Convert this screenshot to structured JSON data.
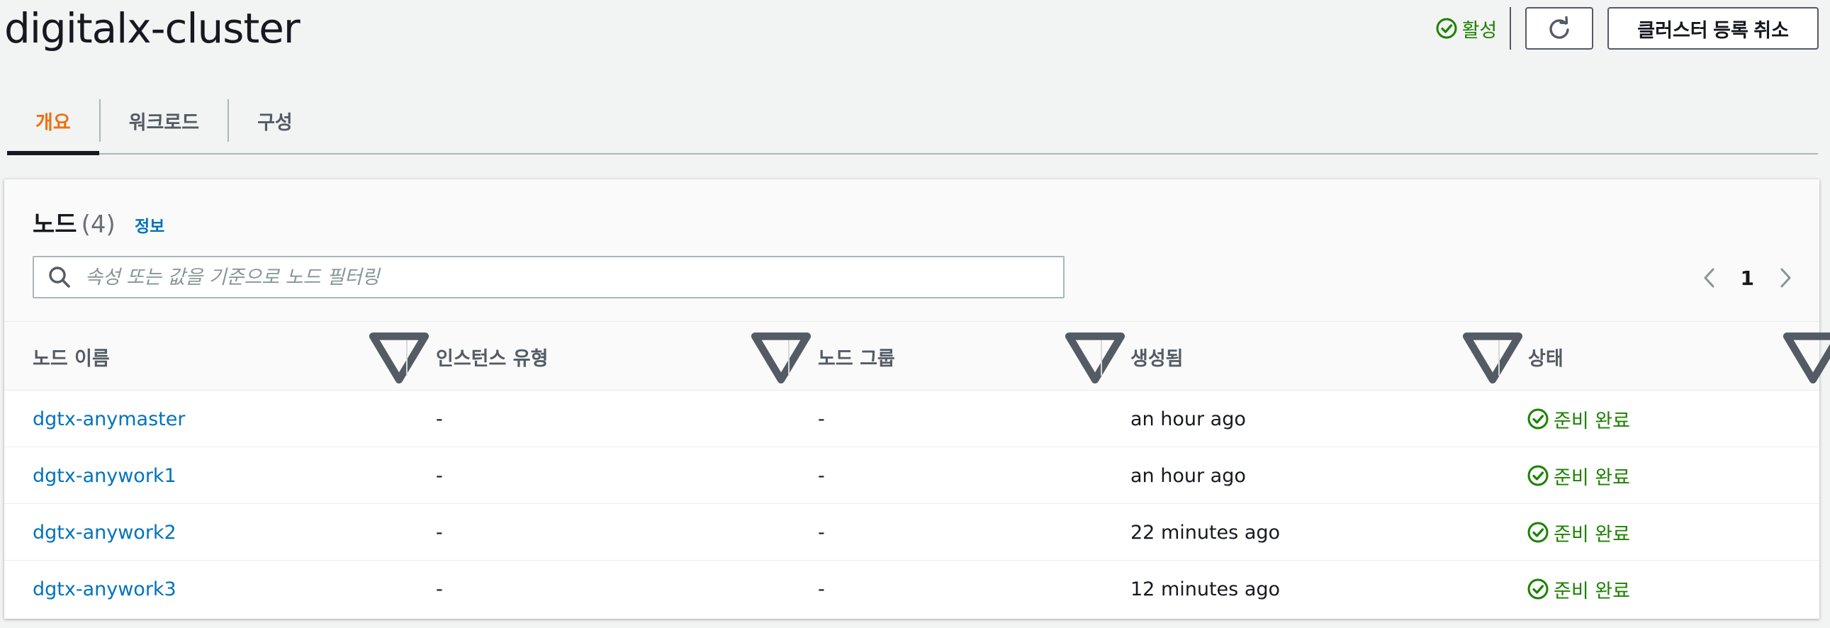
{
  "header": {
    "title": "digitalx-cluster",
    "status_label": "활성",
    "deregister_label": "클러스터 등록 취소"
  },
  "tabs": [
    {
      "label": "개요",
      "active": true
    },
    {
      "label": "워크로드",
      "active": false
    },
    {
      "label": "구성",
      "active": false
    }
  ],
  "nodes_panel": {
    "title": "노드",
    "count": "(4)",
    "info_label": "정보",
    "filter_placeholder": "속성 또는 값을 기준으로 노드 필터링",
    "current_page": "1",
    "columns": [
      "노드 이름",
      "인스턴스 유형",
      "노드 그룹",
      "생성됨",
      "상태"
    ],
    "rows": [
      {
        "name": "dgtx-anymaster",
        "instance_type": "-",
        "node_group": "-",
        "created": "an hour ago",
        "status": "준비 완료"
      },
      {
        "name": "dgtx-anywork1",
        "instance_type": "-",
        "node_group": "-",
        "created": "an hour ago",
        "status": "준비 완료"
      },
      {
        "name": "dgtx-anywork2",
        "instance_type": "-",
        "node_group": "-",
        "created": "22 minutes ago",
        "status": "준비 완료"
      },
      {
        "name": "dgtx-anywork3",
        "instance_type": "-",
        "node_group": "-",
        "created": "12 minutes ago",
        "status": "준비 완료"
      }
    ]
  },
  "colors": {
    "accent_tab": "#ec7211",
    "link": "#0073bb",
    "success": "#1d8102",
    "text": "#16191f",
    "muted": "#545b64"
  }
}
